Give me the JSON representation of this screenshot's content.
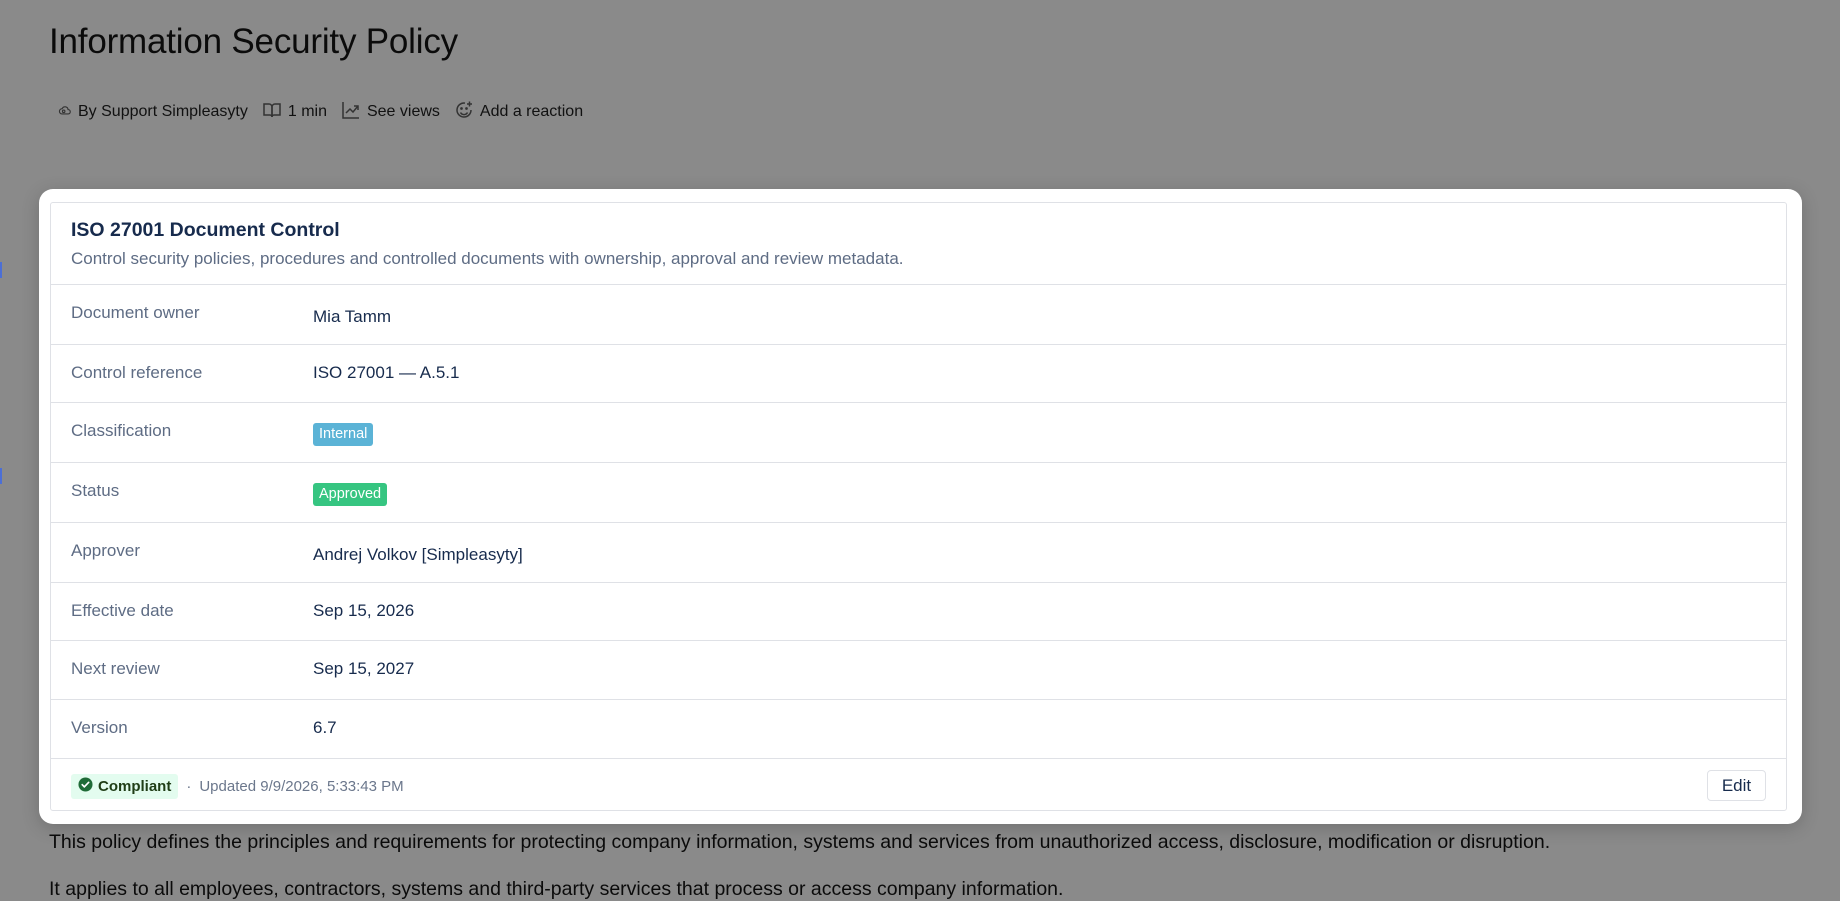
{
  "page": {
    "title": "Information Security Policy",
    "meta": {
      "author": "By Support Simpleasyty",
      "read_time": "1 min",
      "views": "See views",
      "reaction": "Add a reaction"
    },
    "paragraphs": [
      "This policy defines the principles and requirements for protecting company information, systems and services from unauthorized access, disclosure, modification or disruption.",
      "It applies to all employees, contractors, systems and third-party services that process or access company information."
    ]
  },
  "modal": {
    "title": "ISO 27001 Document Control",
    "subtitle": "Control security policies, procedures and controlled documents with ownership, approval and review metadata.",
    "fields": [
      {
        "label": "Document owner",
        "value": "Mia Tamm"
      },
      {
        "label": "Control reference",
        "value": "ISO 27001 — A.5.1"
      },
      {
        "label": "Classification",
        "value": "Internal",
        "badge_color": "#5bb3d6"
      },
      {
        "label": "Status",
        "value": "Approved",
        "badge_color": "#36c581"
      },
      {
        "label": "Approver",
        "value": "Andrej Volkov [Simpleasyty]"
      },
      {
        "label": "Effective date",
        "value": "Sep 15, 2026"
      },
      {
        "label": "Next review",
        "value": "Sep 15, 2027"
      },
      {
        "label": "Version",
        "value": "6.7"
      }
    ],
    "footer": {
      "status": "Compliant",
      "separator": "·",
      "updated": "Updated 9/9/2026, 5:33:43 PM",
      "edit_label": "Edit"
    }
  },
  "colors": {
    "overlay": "#8a8a8a",
    "compliant_bg": "#e3fcef",
    "compliant_icon": "#1f6b37"
  },
  "icons": [
    "cloud-icon",
    "book-icon",
    "trend-chart-icon",
    "add-reaction-icon",
    "check-circle-icon"
  ]
}
